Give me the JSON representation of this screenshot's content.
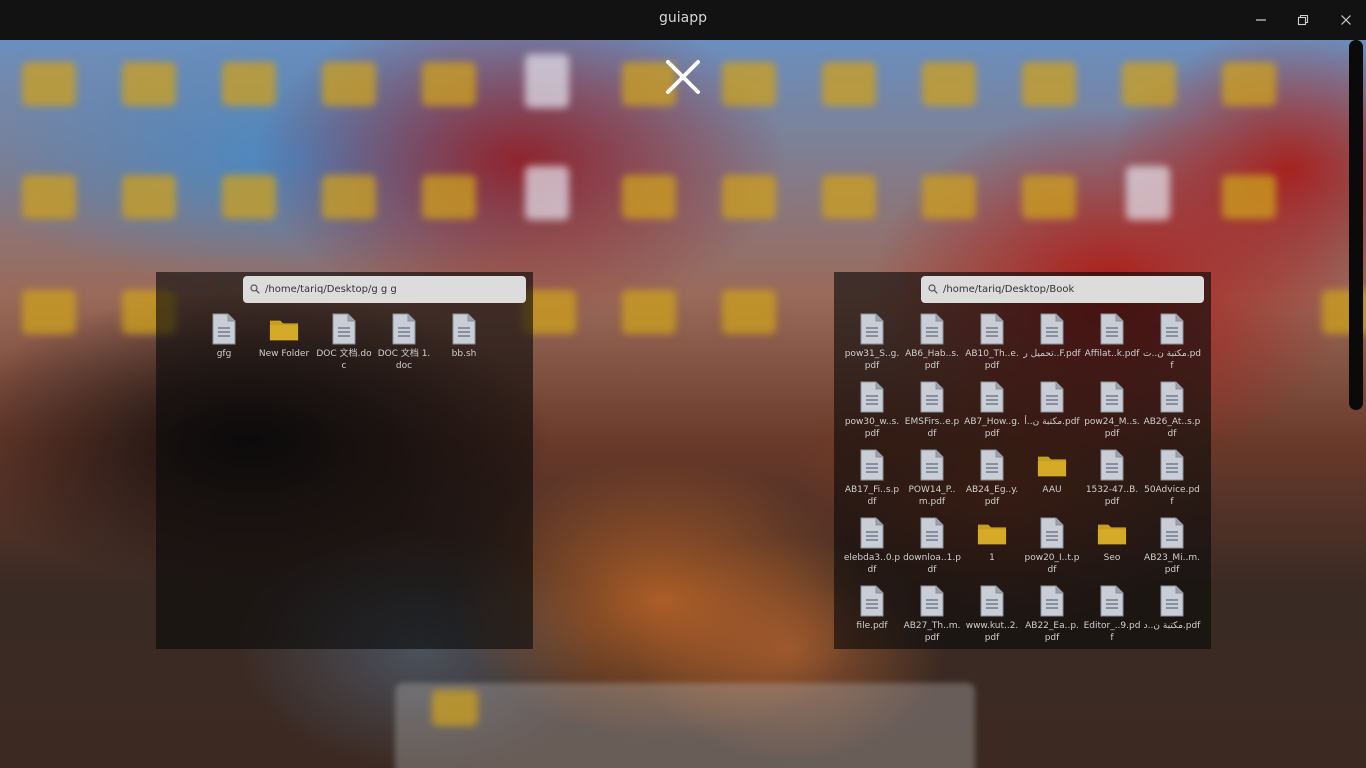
{
  "window": {
    "title": "guiapp",
    "controls": [
      "minimize-icon",
      "maximize-icon",
      "close-icon"
    ]
  },
  "overlay": {
    "close_icon": "close-icon"
  },
  "left_panel": {
    "path": "/home/tariq/Desktop/g g g",
    "items": [
      {
        "label": "gfg",
        "type": "file"
      },
      {
        "label": "New Folder",
        "type": "folder"
      },
      {
        "label": "DOC 文档.doc",
        "type": "file"
      },
      {
        "label": "DOC 文档 1.doc",
        "type": "file"
      },
      {
        "label": "bb.sh",
        "type": "file"
      }
    ]
  },
  "right_panel": {
    "path": "/home/tariq/Desktop/Book",
    "items": [
      {
        "label": "pow31_S..g.pdf",
        "type": "file"
      },
      {
        "label": "AB6_Hab..s.pdf",
        "type": "file"
      },
      {
        "label": "AB10_Th..e.pdf",
        "type": "file"
      },
      {
        "label": "تحميل ر..F.pdf",
        "type": "file"
      },
      {
        "label": "Affilat..k.pdf",
        "type": "file"
      },
      {
        "label": "مكتبة ن..ت.pdf",
        "type": "file"
      },
      {
        "label": "pow30_w..s.pdf",
        "type": "file"
      },
      {
        "label": "EMSFirs..e.pdf",
        "type": "file"
      },
      {
        "label": "AB7_How..g.pdf",
        "type": "file"
      },
      {
        "label": "مكتبة ن..أ.pdf",
        "type": "file"
      },
      {
        "label": "pow24_M..s.pdf",
        "type": "file"
      },
      {
        "label": "AB26_At..s.pdf",
        "type": "file"
      },
      {
        "label": "AB17_Fi..s.pdf",
        "type": "file"
      },
      {
        "label": "POW14_P..m.pdf",
        "type": "file"
      },
      {
        "label": "AB24_Eg..y.pdf",
        "type": "file"
      },
      {
        "label": "AAU",
        "type": "folder"
      },
      {
        "label": "1532-47..B.pdf",
        "type": "file"
      },
      {
        "label": "50Advice.pdf",
        "type": "file"
      },
      {
        "label": "elebda3..0.pdf",
        "type": "file"
      },
      {
        "label": "downloa..1.pdf",
        "type": "file"
      },
      {
        "label": "1",
        "type": "folder"
      },
      {
        "label": "pow20_I..t.pdf",
        "type": "file"
      },
      {
        "label": "Seo",
        "type": "folder"
      },
      {
        "label": "AB23_Mi..m.pdf",
        "type": "file"
      },
      {
        "label": "file.pdf",
        "type": "file"
      },
      {
        "label": "AB27_Th..m.pdf",
        "type": "file"
      },
      {
        "label": "www.kut..2.pdf",
        "type": "file"
      },
      {
        "label": "AB22_Ea..p.pdf",
        "type": "file"
      },
      {
        "label": "Editor_..9.pdf",
        "type": "file"
      },
      {
        "label": "مكتبة ن..د.pdf",
        "type": "file"
      }
    ]
  },
  "colors": {
    "titlebar": "#121212",
    "folder": "#c8a020",
    "file_icon": "#c9ced6",
    "pathbar": "#dcdcdc"
  }
}
